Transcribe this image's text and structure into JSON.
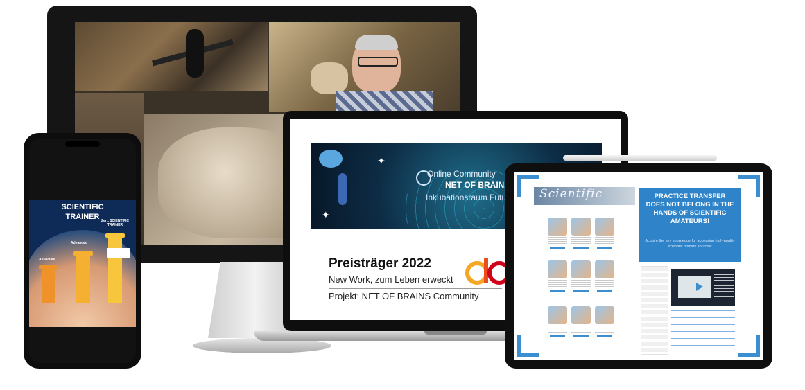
{
  "laptop": {
    "banner": {
      "line1": "Online Community",
      "line2": "NET OF BRAINS",
      "line3": "Inkubationsraum Future"
    },
    "award": {
      "title": "Preisträger 2022",
      "subtitle": "New Work, zum Leben erweckt",
      "project": "Projekt: NET OF BRAINS Community"
    }
  },
  "tablet": {
    "header_word": "Scientific",
    "panel": {
      "title": "PRACTICE TRANSFER DOES NOT BELONG IN THE HANDS OF SCIENTIFIC AMATEURS!",
      "text": "Acquire the key knowledge for accessing high-quality scientific primary sources!"
    }
  },
  "phone": {
    "title_line1": "SCIENTIFIC",
    "title_line2": "TRAINER",
    "tiers": [
      "Associate",
      "Advanced",
      "Zert. SCIENTIFIC TRAINER"
    ]
  },
  "colors": {
    "accent_blue": "#2f83c8",
    "pillar_orange": "#f0922a",
    "pillar_amber": "#f5b031",
    "pillar_yellow": "#f7c63c"
  }
}
